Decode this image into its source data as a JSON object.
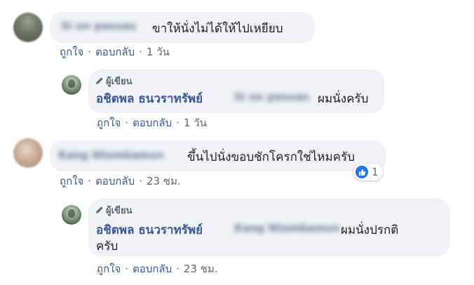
{
  "comments": [
    {
      "author_name": "Si on pasuas",
      "text": "ขาให้นั่งไม่ได้ให้ไปเหยียบ",
      "actions": {
        "like": "ถูกใจ",
        "reply": "ตอบกลับ",
        "separator": "·",
        "time": "1 วัน"
      },
      "reply": {
        "badge": "ผู้เขียน",
        "author_name": "อชิตพล ธนวราทรัพย์",
        "mention": "Si on pasuas",
        "text": "ผมนั่งครับ",
        "actions": {
          "like": "ถูกใจ",
          "reply": "ตอบกลับ",
          "separator": "·",
          "time": "1 วัน"
        }
      }
    },
    {
      "author_name": "Kang Ntombamsn",
      "text": "ขึ้นไปนั่งขอบชักโครกใช่ไหมครับ",
      "reaction": {
        "icon": "like-icon",
        "count": "1"
      },
      "actions": {
        "like": "ถูกใจ",
        "reply": "ตอบกลับ",
        "separator": "·",
        "time": "23 ชม."
      },
      "reply": {
        "badge": "ผู้เขียน",
        "author_name": "อชิตพล ธนวราทรัพย์",
        "mention": "Kang Ntombamsn",
        "text_line1": "ผมนั่งปรกติ",
        "text_line2": "ครับ",
        "actions": {
          "like": "ถูกใจ",
          "reply": "ตอบกลับ",
          "separator": "·",
          "time": "23 ชม."
        }
      }
    }
  ],
  "colors": {
    "link": "#385898",
    "bubble": "#f0f2f5",
    "meta": "#606770",
    "like_blue": "#1877f2"
  }
}
